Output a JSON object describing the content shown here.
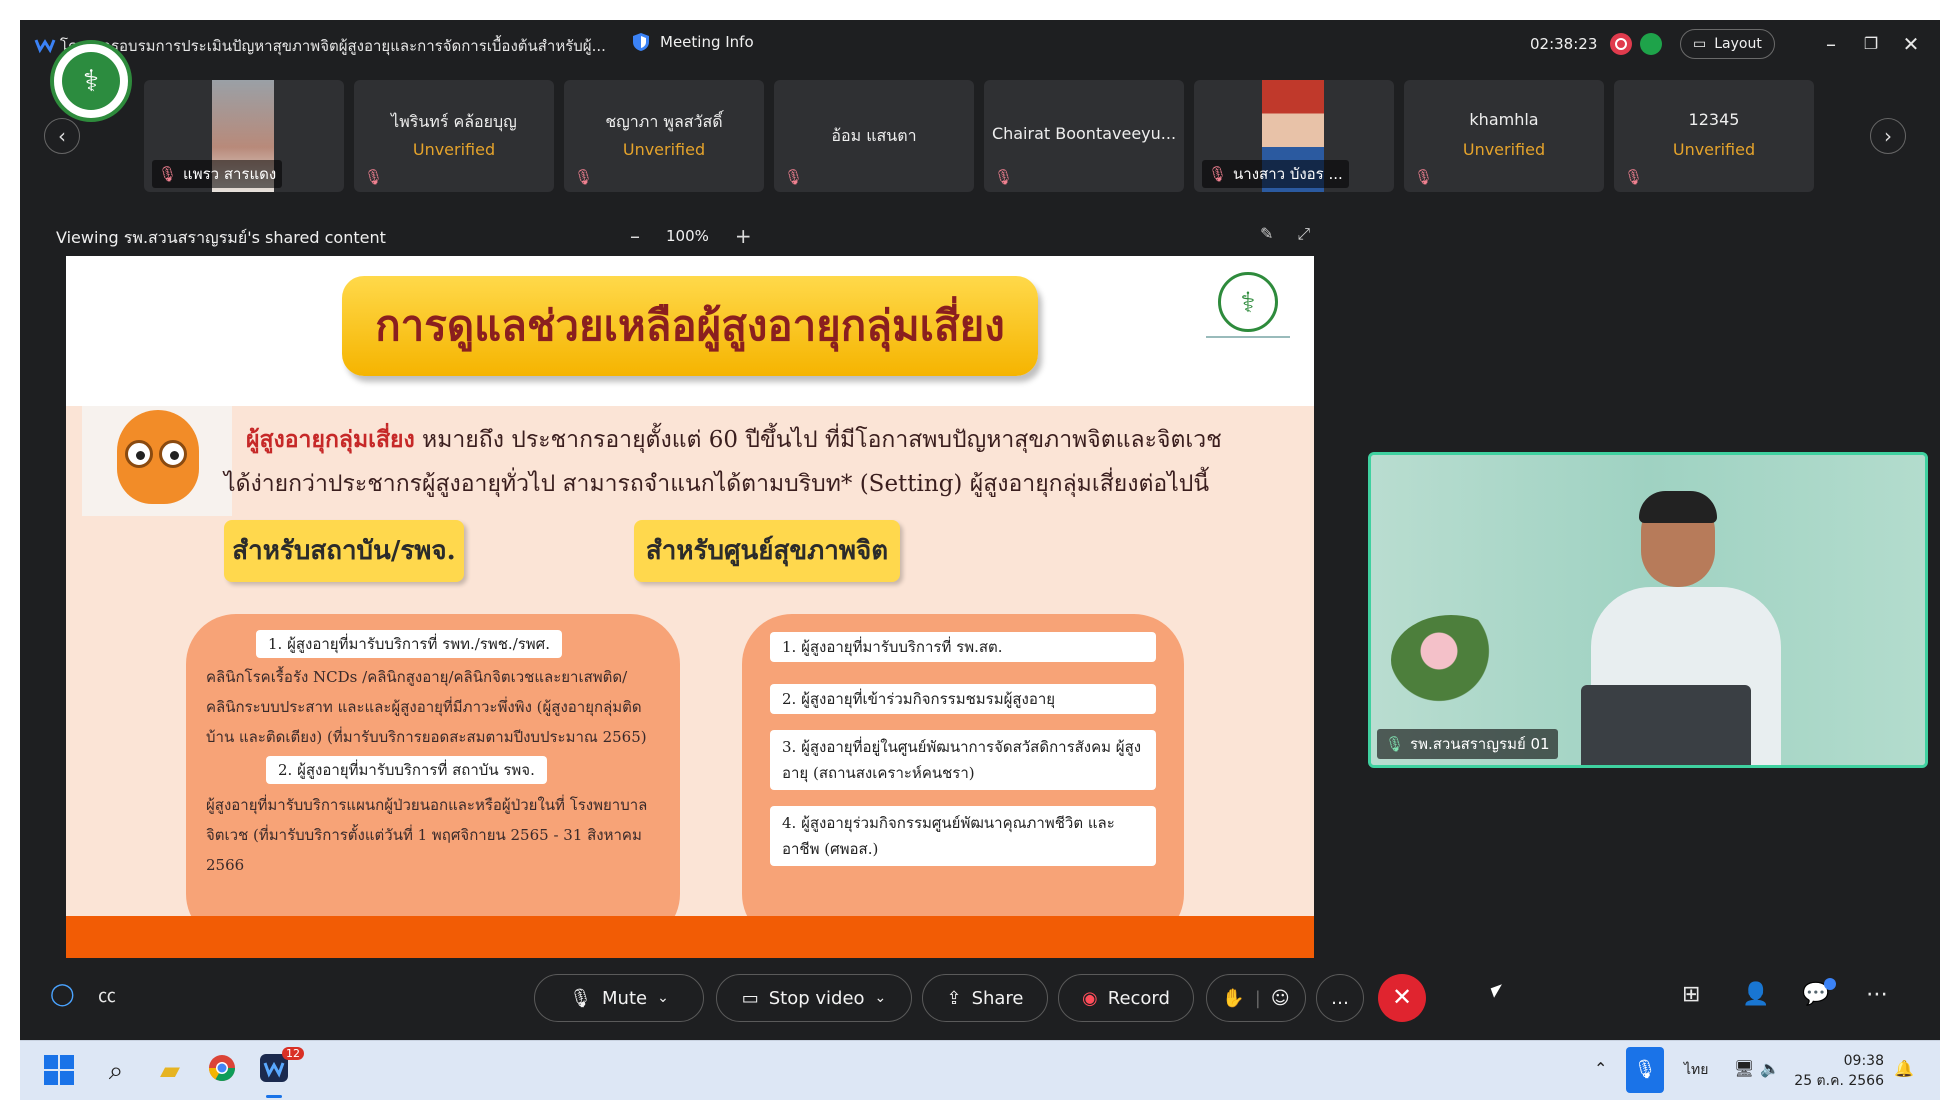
{
  "window": {
    "title": "โครงการอบรมการประเมินปัญหาสุขภาพจิตผู้สูงอายุและการจัดการเบื้องต้นสำหรับผู้...",
    "meeting_info": "Meeting Info",
    "timer": "02:38:23",
    "layout_label": "Layout"
  },
  "participants": [
    {
      "name": "แพรว สารแดง",
      "has_video": true,
      "muted": true,
      "unverified": false
    },
    {
      "name": "ไพรินทร์ คล้อยบุญ",
      "status": "Unverified",
      "muted": true
    },
    {
      "name": "ชญาภา พูลสวัสดิ์",
      "status": "Unverified",
      "muted": true
    },
    {
      "name": "อ้อม แสนตา",
      "muted": true
    },
    {
      "name": "Chairat Boontaveeyu...",
      "muted": true
    },
    {
      "name": "นางสาว บังอร ...",
      "has_video": true,
      "muted": true
    },
    {
      "name": "khamhla",
      "status": "Unverified",
      "muted": true
    },
    {
      "name": "12345",
      "status": "Unverified",
      "muted": true
    }
  ],
  "share": {
    "caption": "Viewing รพ.สวนสราญรมย์'s shared content",
    "zoom": "100%"
  },
  "slide": {
    "title": "การดูแลช่วยเหลือผู้สูงอายุกลุ่มเสี่ยง",
    "intro_highlight": "ผู้สูงอายุกลุ่มเสี่ยง",
    "intro_line1": " หมายถึง ประชากรอายุตั้งแต่ 60 ปีขึ้นไป ที่มีโอกาสพบปัญหาสุขภาพจิตและจิตเวช",
    "intro_line2": "ได้ง่ายกว่าประชากรผู้สูงอายุทั่วไป สามารถจำแนกได้ตามบริบท* (Setting) ผู้สูงอายุกลุ่มเสี่ยงต่อไปนี้",
    "left_heading": "สำหรับสถาบัน/รพจ.",
    "right_heading": "สำหรับศูนย์สุขภาพจิต",
    "left_items": [
      {
        "label": "1. ผู้สูงอายุที่มารับบริการที่ รพท./รพช./รพศ.",
        "desc": "คลินิกโรคเรื้อรัง NCDs /คลินิกสูงอายุ/คลินิกจิตเวชและยาเสพติด/ คลินิกระบบประสาท และและผู้สูงอายุที่มีภาวะพึ่งพิง (ผู้สูงอายุกลุ่มติดบ้าน และติดเตียง) (ที่มารับบริการยอดสะสมตามปีงบประมาณ 2565)"
      },
      {
        "label": "2. ผู้สูงอายุที่มารับบริการที่ สถาบัน รพจ.",
        "desc": "ผู้สูงอายุที่มารับบริการแผนกผู้ป่วยนอกและหรือผู้ป่วยในที่ โรงพยาบาลจิตเวช (ที่มารับบริการตั้งแต่วันที่ 1 พฤศจิกายน 2565 - 31 สิงหาคม 2566"
      }
    ],
    "right_items": [
      "1. ผู้สูงอายุที่มารับบริการที่ รพ.สต.",
      "2. ผู้สูงอายุที่เข้าร่วมกิจกรรมชมรมผู้สูงอายุ",
      "3. ผู้สูงอายุที่อยู่ในศูนย์พัฒนาการจัดสวัสดิการสังคม ผู้สูงอายุ (สถานสงเคราะห์คนชรา)",
      "4. ผู้สูงอายุร่วมกิจกรรมศูนย์พัฒนาคุณภาพชีวิต และอาชีพ (ศพอส.)"
    ]
  },
  "self_view": {
    "label": "รพ.สวนสราญรมย์ 01"
  },
  "toolbar": {
    "mute": "Mute",
    "stop_video": "Stop video",
    "share": "Share",
    "record": "Record"
  },
  "taskbar": {
    "time": "09:38",
    "date": "25 ต.ค. 2566",
    "lang": "ไทย",
    "badge": "12"
  },
  "colors": {
    "accent_green": "#3fd1a0",
    "end_call": "#e0242f",
    "unverified": "#e5a32b",
    "slide_orange": "#f25c05"
  }
}
